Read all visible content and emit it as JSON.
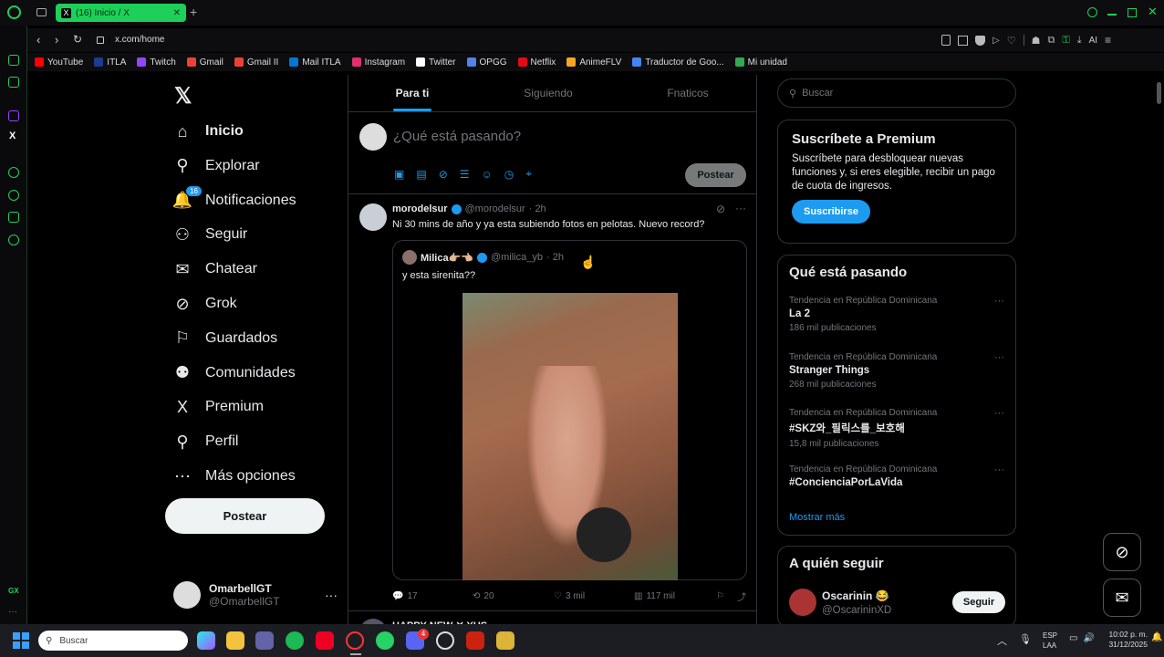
{
  "browser": {
    "tab_title": "(16) Inicio / X",
    "url": "x.com/home",
    "ai_label": "AI",
    "bookmarks": [
      {
        "label": "YouTube",
        "color": "#ff0000"
      },
      {
        "label": "ITLA",
        "color": "#1a3d8f"
      },
      {
        "label": "Twitch",
        "color": "#9146ff"
      },
      {
        "label": "Gmail",
        "color": "#ea4335"
      },
      {
        "label": "Gmail II",
        "color": "#ea4335"
      },
      {
        "label": "Mail ITLA",
        "color": "#0078d4"
      },
      {
        "label": "Instagram",
        "color": "#e1306c"
      },
      {
        "label": "Twitter",
        "color": "#ffffff"
      },
      {
        "label": "OPGG",
        "color": "#5383e8"
      },
      {
        "label": "Netflix",
        "color": "#e50914"
      },
      {
        "label": "AnimeFLV",
        "color": "#f5a623"
      },
      {
        "label": "Traductor de Goo...",
        "color": "#4285f4"
      },
      {
        "label": "Mi unidad",
        "color": "#34a853"
      }
    ]
  },
  "nav": {
    "items": [
      {
        "label": "Inicio",
        "icon": "home-icon",
        "glyph": "⌂"
      },
      {
        "label": "Explorar",
        "icon": "search-icon",
        "glyph": "⚲"
      },
      {
        "label": "Notificaciones",
        "icon": "bell-icon",
        "glyph": "🔔"
      },
      {
        "label": "Seguir",
        "icon": "add-user-icon",
        "glyph": "⚇"
      },
      {
        "label": "Chatear",
        "icon": "mail-icon",
        "glyph": "✉"
      },
      {
        "label": "Grok",
        "icon": "grok-icon",
        "glyph": "⊘"
      },
      {
        "label": "Guardados",
        "icon": "bookmark-icon",
        "glyph": "⚐"
      },
      {
        "label": "Comunidades",
        "icon": "communities-icon",
        "glyph": "⚉"
      },
      {
        "label": "Premium",
        "icon": "x-logo-icon",
        "glyph": "X"
      },
      {
        "label": "Perfil",
        "icon": "profile-icon",
        "glyph": "⚲"
      },
      {
        "label": "Más opciones",
        "icon": "more-circle-icon",
        "glyph": "⋯"
      }
    ],
    "notif_badge": "16",
    "post_label": "Postear",
    "account": {
      "name": "OmarbellGT",
      "handle": "@OmarbellGT"
    }
  },
  "feed": {
    "tabs": [
      "Para ti",
      "Siguiendo",
      "Fnaticos"
    ],
    "composer_placeholder": "¿Qué está pasando?",
    "composer_post": "Postear",
    "tweet": {
      "name": "morodelsur",
      "handle": "@morodelsur",
      "time": "· 2h",
      "text": "Ni 30 mins de año y ya esta subiendo fotos en pelotas. Nuevo record?",
      "quote": {
        "name": "Milica👉🏼👈🏼",
        "handle": "@milica_yb",
        "time": "· 2h",
        "text": "y esta sirenita??"
      },
      "stats": {
        "replies": "17",
        "reposts": "20",
        "likes": "3 mil",
        "views": "117 mil"
      }
    },
    "next_tweet_partial": "HAPPY NEW ✕ YUS"
  },
  "right": {
    "search_placeholder": "Buscar",
    "premium": {
      "title": "Suscríbete a Premium",
      "body": "Suscríbete para desbloquear nuevas funciones y, si eres elegible, recibir un pago de cuota de ingresos.",
      "button": "Suscribirse"
    },
    "trends": {
      "title": "Qué está pasando",
      "items": [
        {
          "context": "Tendencia en República Dominicana",
          "name": "La 2",
          "count": "186 mil publicaciones"
        },
        {
          "context": "Tendencia en República Dominicana",
          "name": "Stranger Things",
          "count": "268 mil publicaciones"
        },
        {
          "context": "Tendencia en República Dominicana",
          "name": "#SKZ와_필릭스를_보호해",
          "count": "15,8 mil publicaciones"
        },
        {
          "context": "Tendencia en República Dominicana",
          "name": "#ConcienciaPorLaVida",
          "count": ""
        }
      ],
      "show_more": "Mostrar más"
    },
    "follow": {
      "title": "A quién seguir",
      "name": "Oscarinin 😂",
      "handle": "@OscarininXD",
      "button": "Seguir"
    }
  },
  "taskbar": {
    "search_placeholder": "Buscar",
    "lang_top": "ESP",
    "lang_bottom": "LAA",
    "time": "10:02 p. m.",
    "date": "31/12/2025",
    "opera_badge": "4"
  }
}
